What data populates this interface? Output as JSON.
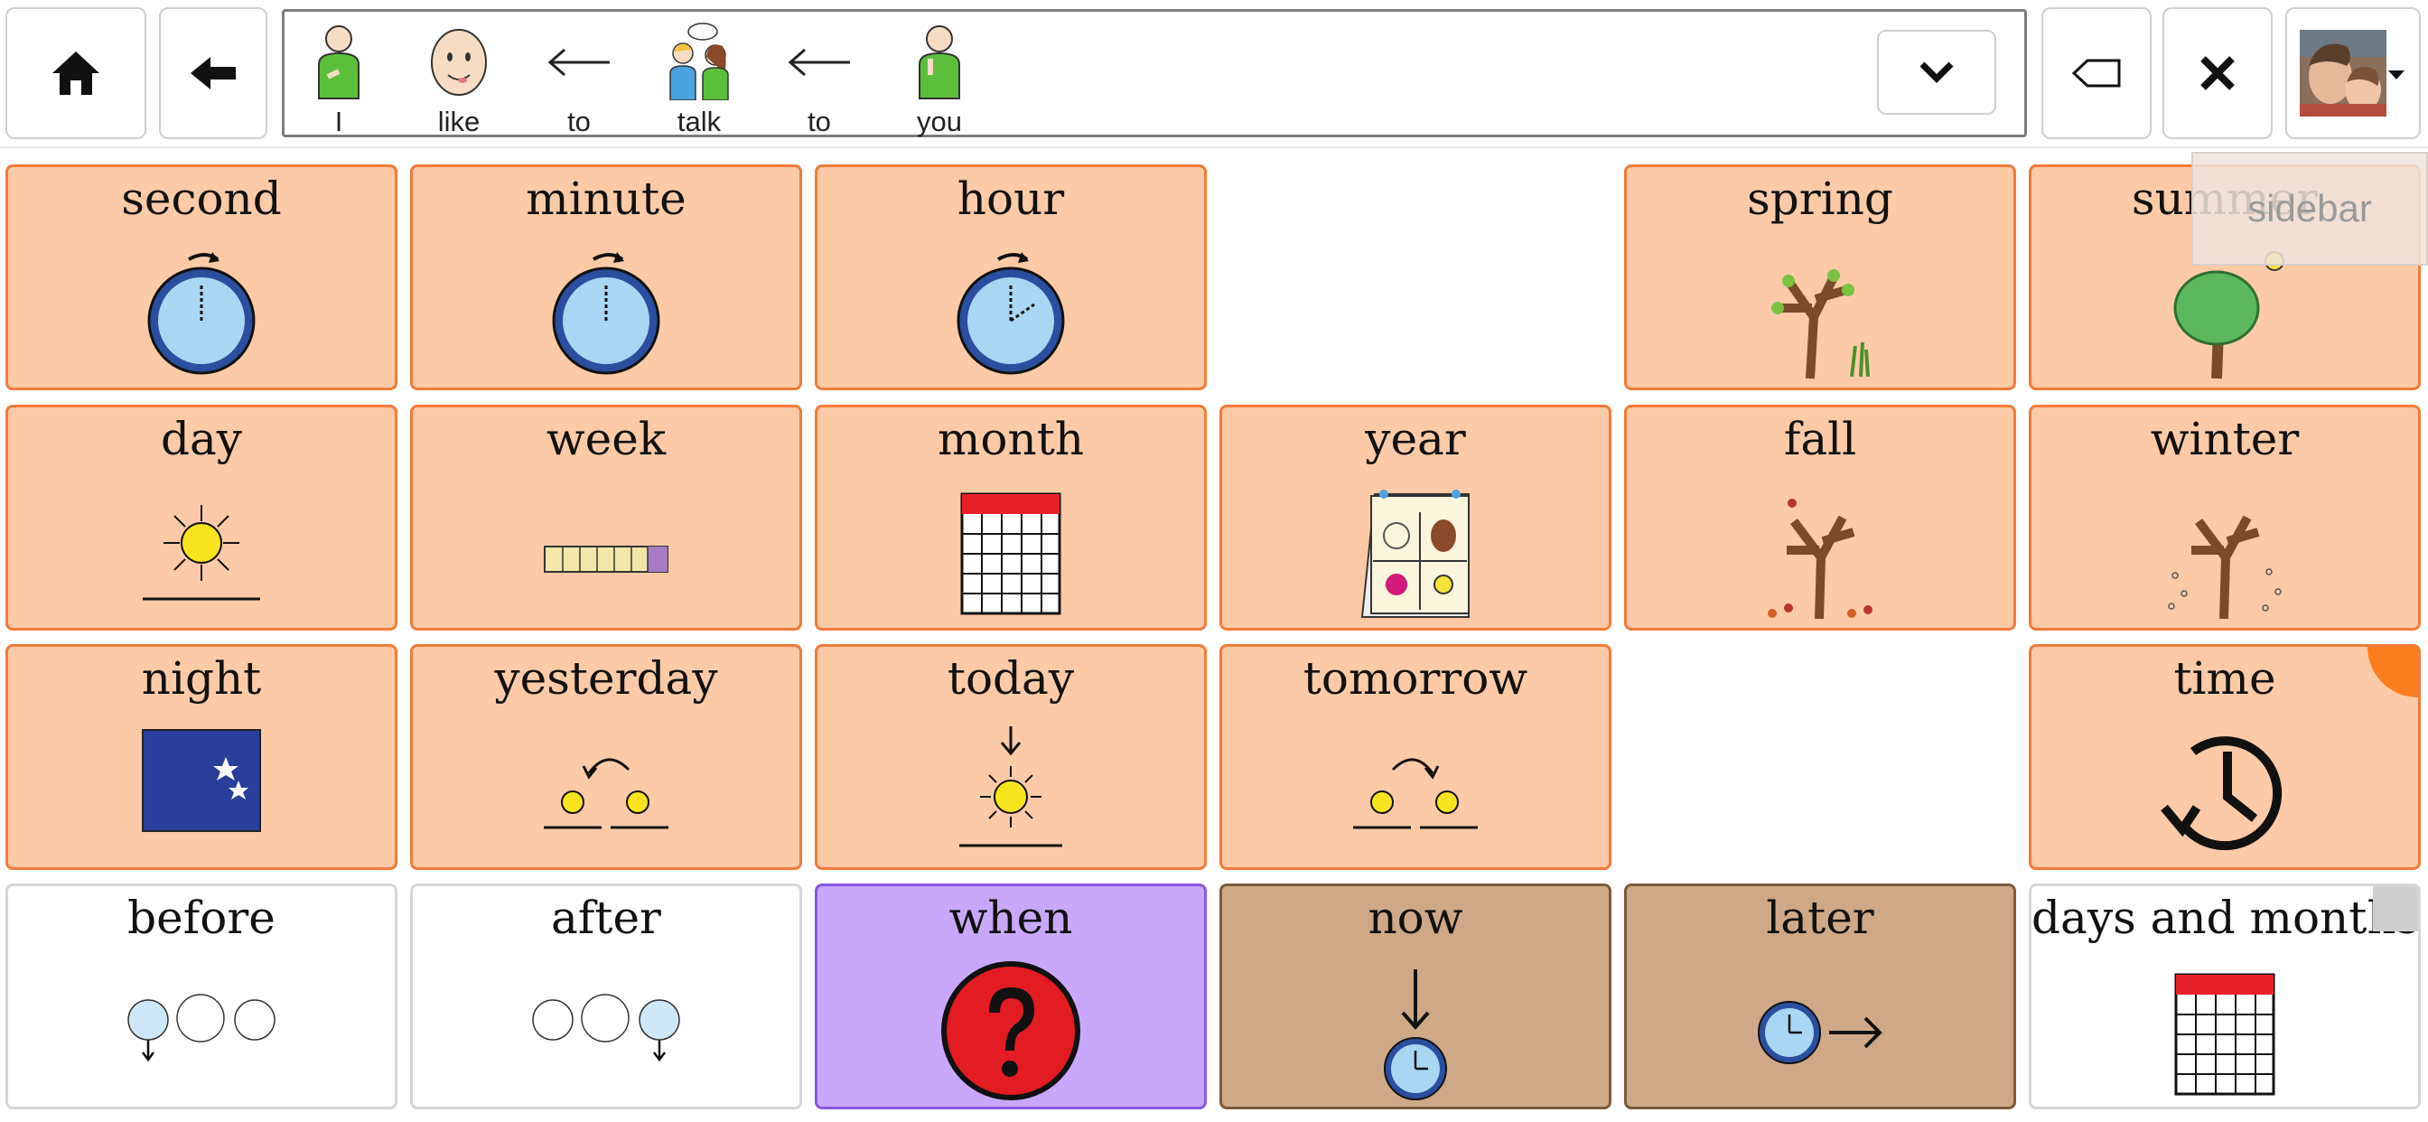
{
  "toolbar": {
    "home_icon": "home-icon",
    "back_icon": "back-arrow-icon",
    "expand_icon": "chevron-down-icon",
    "clear_icon": "backspace-icon",
    "close_icon": "close-icon",
    "user_icon": "user-avatar"
  },
  "sentence": {
    "words": [
      {
        "label": "I",
        "icon": "person-pointing-self-icon"
      },
      {
        "label": "like",
        "icon": "smiling-face-icon"
      },
      {
        "label": "to",
        "icon": "left-arrow-icon"
      },
      {
        "label": "talk",
        "icon": "people-talking-icon"
      },
      {
        "label": "to",
        "icon": "left-arrow-icon"
      },
      {
        "label": "you",
        "icon": "person-pointing-icon"
      }
    ]
  },
  "sidebar": {
    "label": "sidebar"
  },
  "grid": {
    "second": "second",
    "minute": "minute",
    "hour": "hour",
    "spring": "spring",
    "summer": "summer",
    "day": "day",
    "week": "week",
    "month": "month",
    "year": "year",
    "fall": "fall",
    "winter": "winter",
    "night": "night",
    "yesterday": "yesterday",
    "today": "today",
    "tomorrow": "tomorrow",
    "time": "time",
    "before": "before",
    "after": "after",
    "when": "when",
    "now": "now",
    "later": "later",
    "days_and_months": "days and months"
  },
  "colors": {
    "core_cell": "#fccaa7",
    "core_border": "#f27a3a",
    "question_cell": "#c9a8fb",
    "adverb_cell": "#cfa987",
    "folder_corner": "#fa7e1e"
  }
}
